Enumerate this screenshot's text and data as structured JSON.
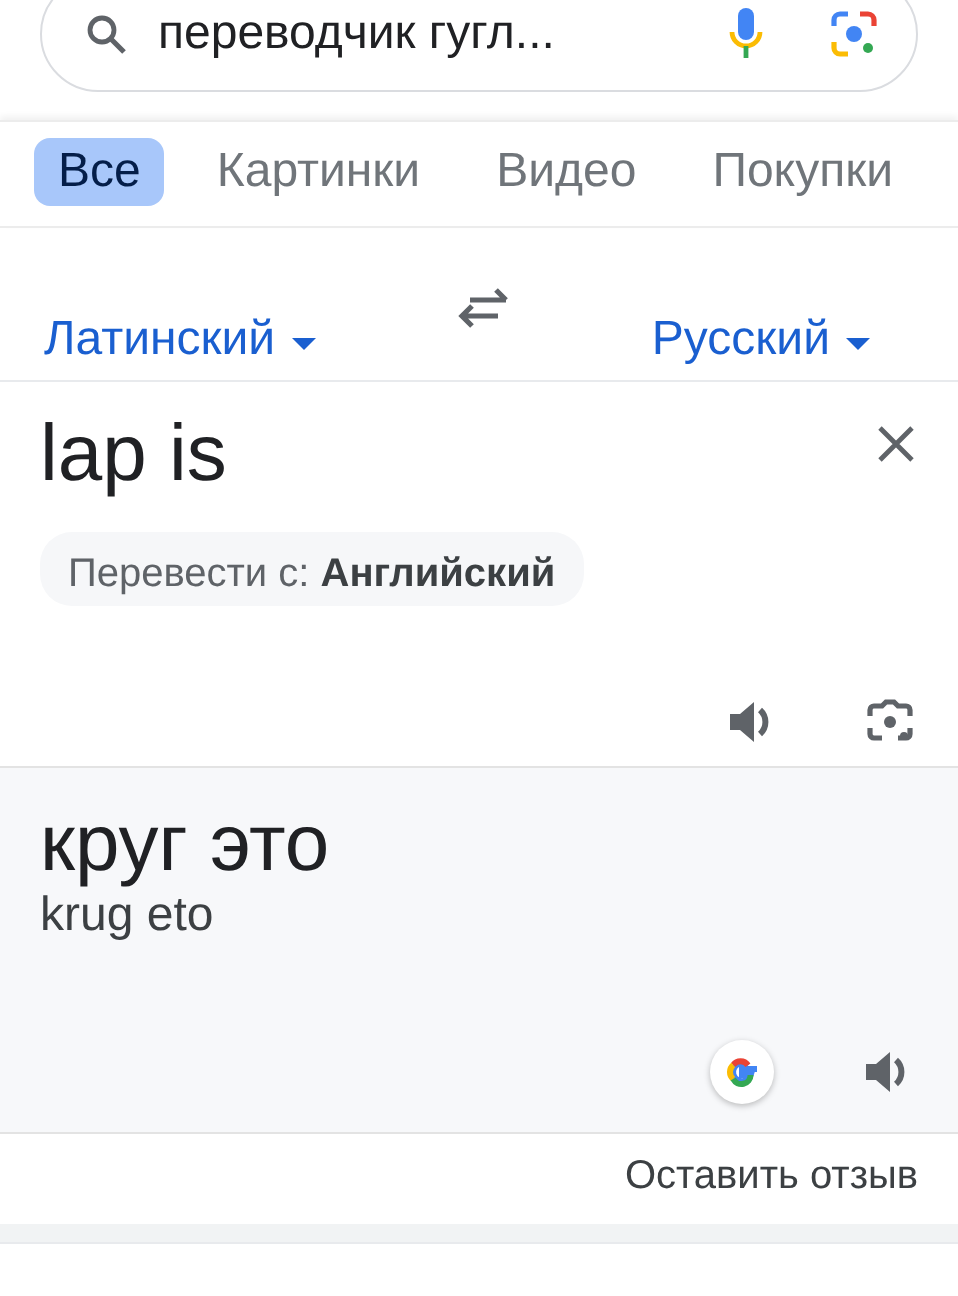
{
  "search": {
    "value": "переводчик гугл..."
  },
  "tabs": [
    {
      "label": "Все",
      "selected": true
    },
    {
      "label": "Картинки",
      "selected": false
    },
    {
      "label": "Видео",
      "selected": false
    },
    {
      "label": "Покупки",
      "selected": false
    }
  ],
  "translator": {
    "source_language": "Латинский",
    "target_language": "Русский",
    "input_text": "lap is",
    "detected": "Перевести с: **Английский**",
    "translation": "круг это",
    "transliteration": "krug eto"
  },
  "feedback_link": "Оставить отзыв"
}
